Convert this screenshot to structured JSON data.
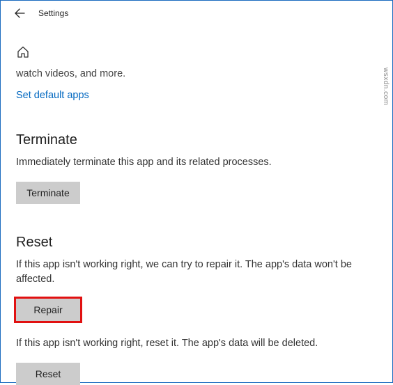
{
  "header": {
    "title": "Settings"
  },
  "truncated_line": "watch videos, and more.",
  "default_apps_link": "Set default apps",
  "terminate": {
    "heading": "Terminate",
    "description": "Immediately terminate this app and its related processes.",
    "button": "Terminate"
  },
  "reset": {
    "heading": "Reset",
    "repair_description": "If this app isn't working right, we can try to repair it. The app's data won't be affected.",
    "repair_button": "Repair",
    "reset_description": "If this app isn't working right, reset it. The app's data will be deleted.",
    "reset_button": "Reset"
  },
  "watermark": "wsxdn.com"
}
